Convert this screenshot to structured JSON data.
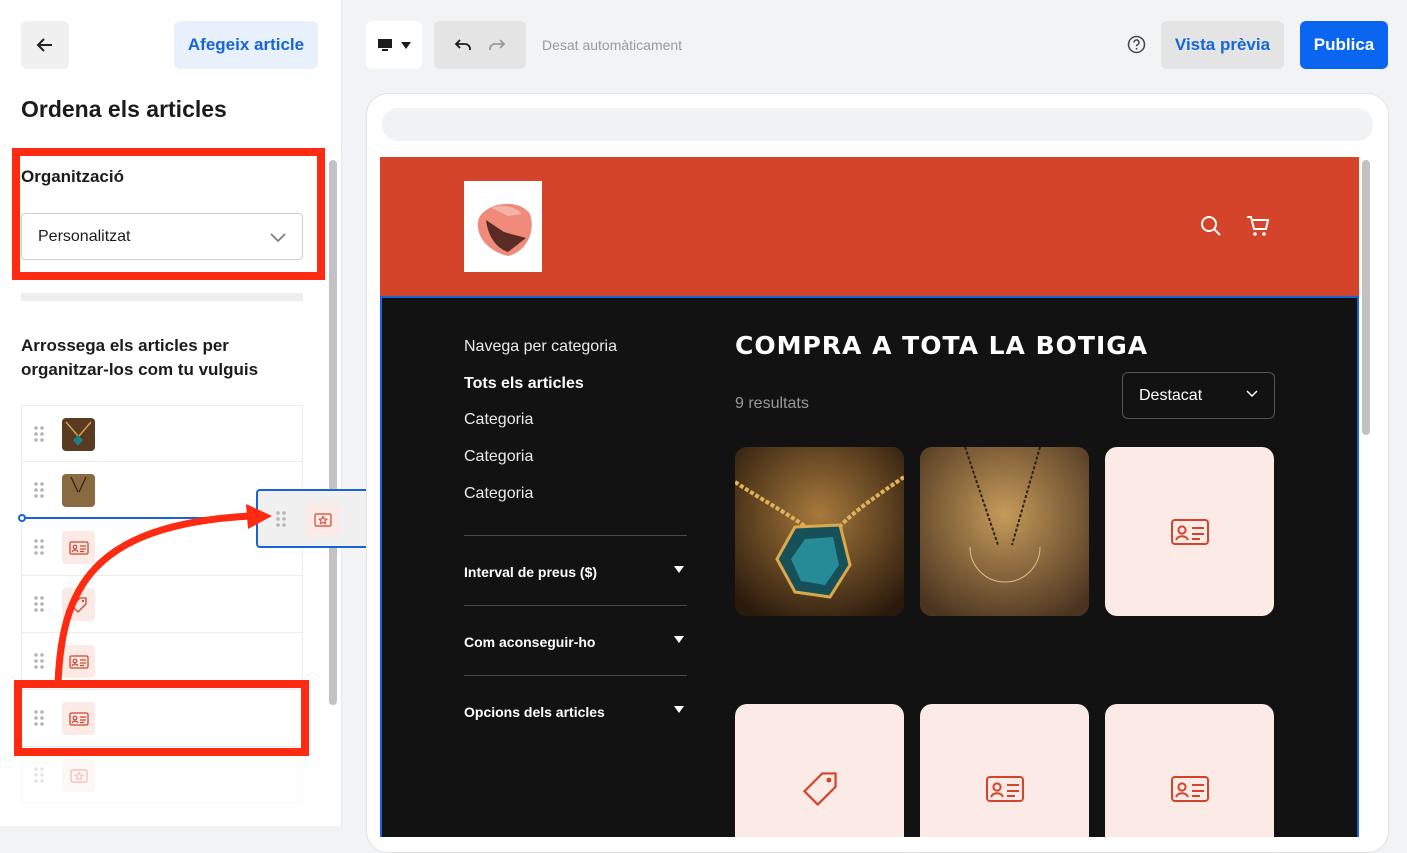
{
  "left_panel": {
    "add_button_label": "Afegeix article",
    "title": "Ordena els articles",
    "organization_label": "Organització",
    "organization_value": "Personalitzat",
    "drag_instructions": "Arrossega els articles per organitzar-los com tu vulguis",
    "items": [
      {
        "thumb": "teal-pendant-photo"
      },
      {
        "thumb": "crescent-pendant-photo"
      },
      {
        "thumb": "id-card-icon"
      },
      {
        "thumb": "tag-icon"
      },
      {
        "thumb": "id-card-icon"
      },
      {
        "thumb": "id-card-icon"
      },
      {
        "thumb": "star-ticket-icon"
      }
    ],
    "dragged_item_thumb": "star-ticket-icon"
  },
  "toolbar": {
    "autosave_text": "Desat automàticament",
    "preview_label": "Vista prèvia",
    "publish_label": "Publica"
  },
  "store": {
    "nav_title": "Navega per categoria",
    "nav_items": [
      "Tots els articles",
      "Categoria",
      "Categoria",
      "Categoria"
    ],
    "filters": [
      "Interval de preus ($)",
      "Com aconseguir-ho",
      "Opcions dels articles"
    ],
    "heading": "COMPRA A TOTA LA BOTIGA",
    "results_text": "9 resultats",
    "sort_value": "Destacat",
    "products": [
      {
        "kind": "teal-pendant-photo"
      },
      {
        "kind": "crescent-pendant-photo"
      },
      {
        "kind": "id-card-icon"
      },
      {
        "kind": "tag-icon"
      },
      {
        "kind": "id-card-icon"
      },
      {
        "kind": "id-card-icon"
      }
    ]
  },
  "colors": {
    "accent": "#0a66f0",
    "header": "#d3442b",
    "annotation": "#ff2a12",
    "store_bg": "#121212"
  }
}
